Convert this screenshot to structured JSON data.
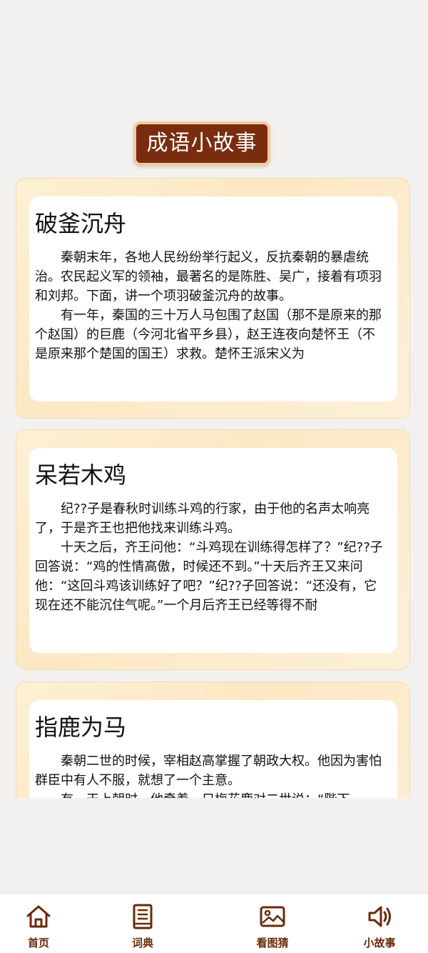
{
  "header": {
    "title": "成语小故事"
  },
  "stories": [
    {
      "title": "破釜沉舟",
      "paragraphs": [
        "秦朝末年，各地人民纷纷举行起义，反抗秦朝的暴虐统治。农民起义军的领袖，最著名的是陈胜、吴广，接着有项羽和刘邦。下面，讲一个项羽破釜沉舟的故事。",
        "有一年，秦国的三十万人马包围了赵国（那不是原来的那个赵国）的巨鹿（今河北省平乡县），赵王连夜向楚怀王（不是原来那个楚国的国王）求救。楚怀王派宋义为"
      ]
    },
    {
      "title": "呆若木鸡",
      "paragraphs": [
        "纪??子是春秋时训练斗鸡的行家，由于他的名声太响亮了，于是齐王也把他找来训练斗鸡。",
        "十天之后，齐王问他：“斗鸡现在训练得怎样了？”纪??子回答说：“鸡的性情高傲，时候还不到。”十天后齐王又来问他：“这回斗鸡该训练好了吧？”纪??子回答说：“还没有，它现在还不能沉住气呢。”一个月后齐王已经等得不耐"
      ]
    },
    {
      "title": "指鹿为马",
      "paragraphs": [
        "秦朝二世的时候，宰相赵高掌握了朝政大权。他因为害怕群臣中有人不服，就想了一个主意。",
        "有一天上朝时，他牵着一只梅花鹿对二世说：“陛下"
      ]
    }
  ],
  "bottom_nav": {
    "items": [
      {
        "label": "首页",
        "icon": "home-icon"
      },
      {
        "label": "词典",
        "icon": "book-icon"
      },
      {
        "label": "看图猜",
        "icon": "image-icon"
      },
      {
        "label": "小故事",
        "icon": "speaker-icon"
      }
    ]
  }
}
